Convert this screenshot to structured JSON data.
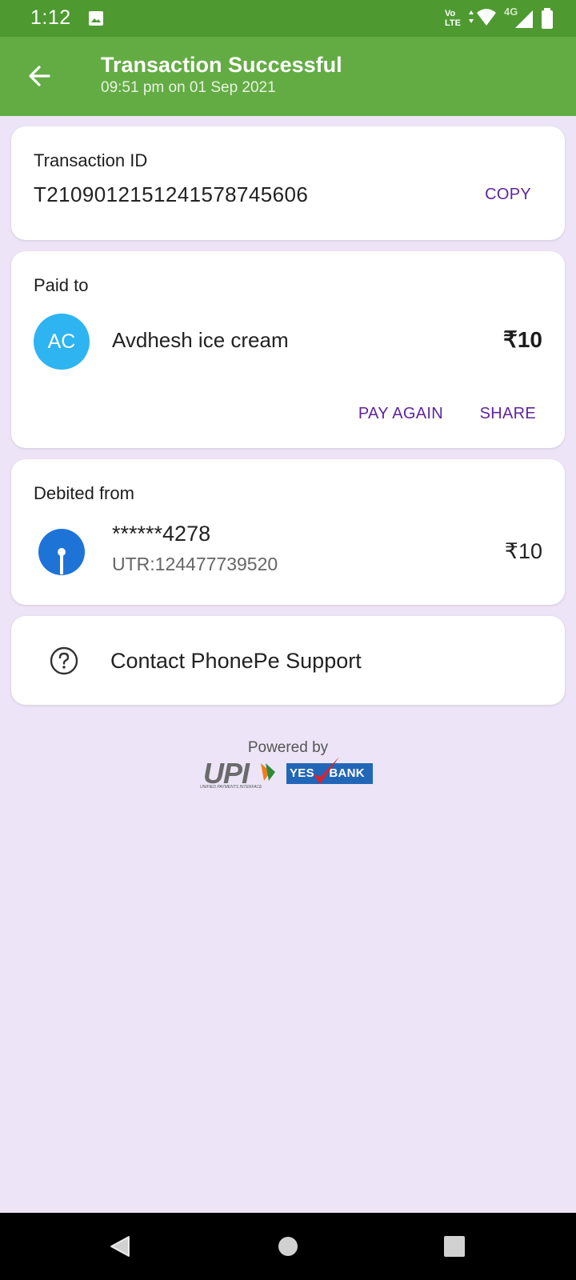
{
  "status_bar": {
    "time": "1:12",
    "volte_top": "Vo",
    "volte_bottom": "LTE",
    "network": "4G"
  },
  "app_bar": {
    "title": "Transaction Successful",
    "subtitle": "09:51 pm on 01 Sep 2021"
  },
  "transaction": {
    "label": "Transaction ID",
    "id": "T2109012151241578745606",
    "copy_label": "COPY"
  },
  "paid_to": {
    "label": "Paid to",
    "avatar_initials": "AC",
    "name": "Avdhesh ice cream",
    "amount": "₹10",
    "pay_again_label": "PAY AGAIN",
    "share_label": "SHARE"
  },
  "debited_from": {
    "label": "Debited from",
    "account": "******4278",
    "utr": "UTR:124477739520",
    "amount": "₹10"
  },
  "support": {
    "label": "Contact PhonePe Support"
  },
  "footer": {
    "powered_by": "Powered by",
    "upi_text": "UPI",
    "upi_subtext": "UNIFIED PAYMENTS INTERFACE",
    "bank_text": "YES BANK"
  },
  "colors": {
    "status_bar": "#4e9a31",
    "app_bar": "#63ac44",
    "accent": "#5f259f",
    "background": "#ede5f7",
    "avatar": "#2eb4f0",
    "bank_logo": "#1e73d6"
  },
  "icons": {
    "back": "arrow-left-icon",
    "help": "question-circle-icon",
    "bank": "sbi-logo-icon"
  }
}
